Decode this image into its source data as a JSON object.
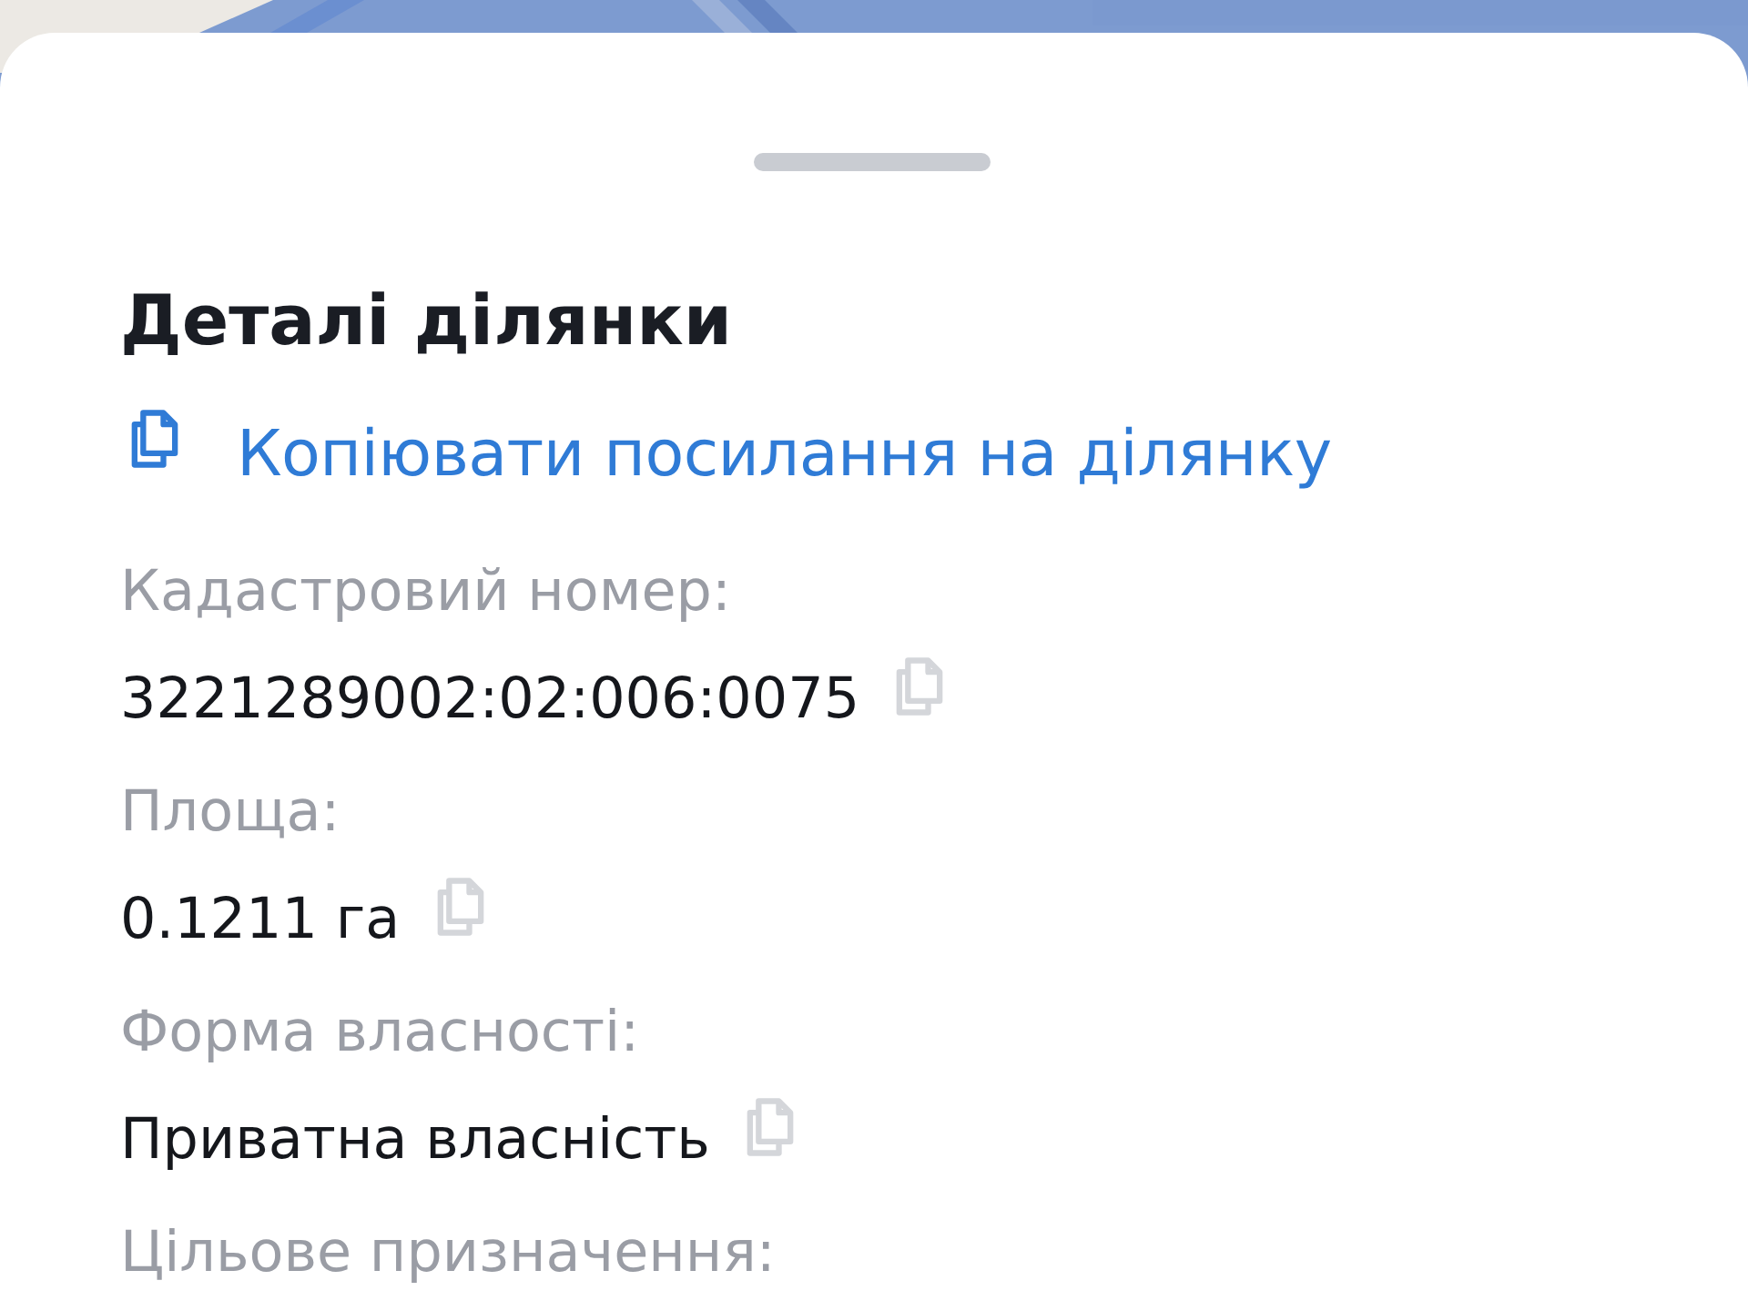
{
  "sheet": {
    "title": "Деталі ділянки",
    "copy_link": "Копіювати посилання на ділянку",
    "fields": [
      {
        "label": "Кадастровий номер:",
        "value": "3221289002:02:006:0075"
      },
      {
        "label": "Площа:",
        "value": "0.1211 га"
      },
      {
        "label": "Форма власності:",
        "value": "Приватна власність"
      },
      {
        "label": "Цільове призначення:"
      }
    ]
  }
}
